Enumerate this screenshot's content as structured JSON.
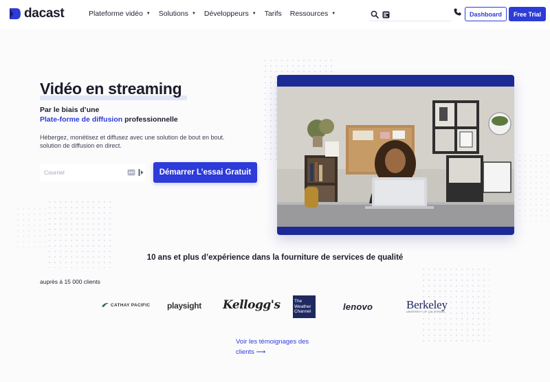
{
  "header": {
    "brand": "dacast",
    "nav": [
      {
        "label": "Plateforme vidéo",
        "has_caret": true
      },
      {
        "label": "Solutions",
        "has_caret": true
      },
      {
        "label": "Développeurs",
        "has_caret": true
      },
      {
        "label": "Tarifs",
        "has_caret": false
      },
      {
        "label": "Ressources",
        "has_caret": true
      }
    ],
    "caret_glyph": "▼",
    "dashboard_label": "Dashboard",
    "free_trial_label": "Free Trial",
    "icons": [
      "search-icon",
      "lang-icon",
      "phone-icon"
    ]
  },
  "hero": {
    "title": "Vidéo en streaming",
    "subtitle_line1": "Par le biais d’une",
    "subtitle_highlight": "Plate-forme de diffusion",
    "subtitle_rest": " professionnelle",
    "description": "Hébergez, monétisez et diffusez avec une solution de bout en bout. solution de diffusion en direct.",
    "email_placeholder": "Courriel",
    "cta_label": "Démarrer L’essai Gratuit"
  },
  "social_proof": {
    "experience": "10 ans et plus d’expérience dans la fourniture de services de qualité",
    "clients_count": "auprès à 15 000 clients",
    "logos": {
      "cathay": "CATHAY PACIFIC",
      "playsight": "playsight",
      "kelloggs": "Kellogg's",
      "weather": "The Weather Channel",
      "lenovo": "lenovo",
      "berkeley": "Berkeley",
      "berkeley_sub": "UNIVERSITY OF CALIFORNIA"
    },
    "testimonials_link": "Voir les témoignages des clients ⟶"
  },
  "colors": {
    "brand_blue": "#2d3bd8",
    "video_frame": "#1c2a96",
    "text_dark": "#1a1c2b"
  }
}
